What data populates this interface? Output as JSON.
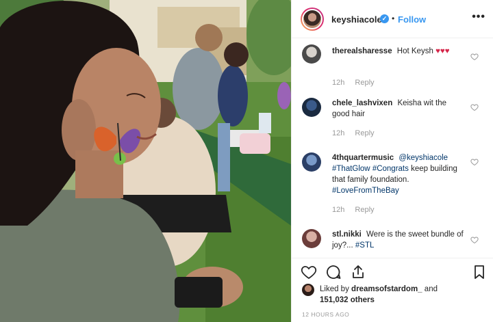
{
  "header": {
    "username": "keyshiacole",
    "verified_mark": "✓",
    "separator": "•",
    "follow_label": "Follow",
    "more_label": "•••"
  },
  "comments": [
    {
      "username": "therealsharesse",
      "text": "Hot Keysh",
      "emoji": "♥♥♥",
      "time": "12h",
      "reply_label": "Reply"
    },
    {
      "username": "chele_lashvixen",
      "text": "Keisha wit the good hair",
      "emoji": "",
      "time": "12h",
      "reply_label": "Reply"
    },
    {
      "username": "4thquartermusic",
      "mention": "@keyshiacole",
      "tag1": "#ThatGlow",
      "tag2": "#Congrats",
      "text": "keep building that family foundation.",
      "tag3": "#LoveFromTheBay",
      "time": "12h",
      "reply_label": "Reply"
    },
    {
      "username": "stl.nikki",
      "text": "Were is the sweet bundle of joy?...",
      "tag": "#STL"
    }
  ],
  "likes": {
    "prefix": "Liked by",
    "user": "dreamsofstardom_",
    "and": "and",
    "count": "151,032 others"
  },
  "timestamp": "12 HOURS AGO",
  "icons": [
    "heart-icon",
    "comment-icon",
    "share-icon",
    "bookmark-icon",
    "more-icon",
    "verified-badge-icon"
  ],
  "colors": {
    "accent": "#3897f0",
    "text": "#262626",
    "meta": "#999999",
    "border": "#efefef"
  }
}
